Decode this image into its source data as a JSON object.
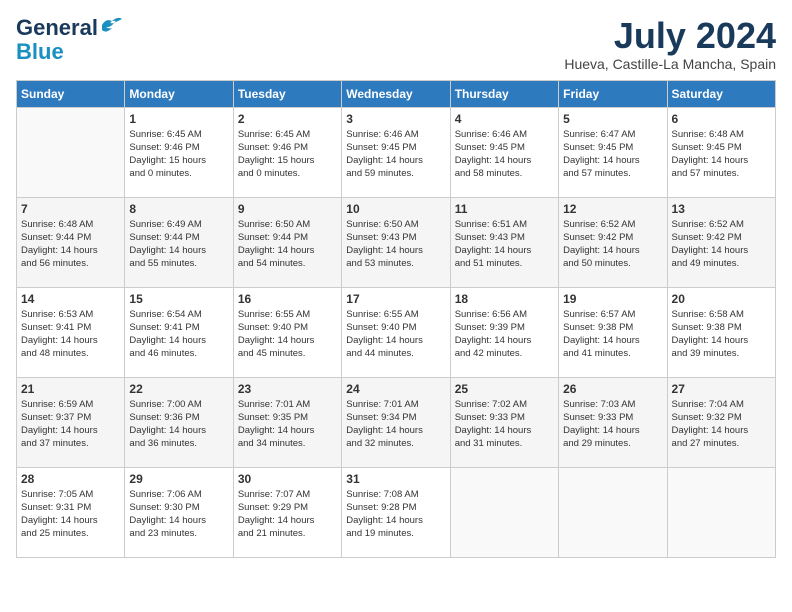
{
  "logo": {
    "general": "General",
    "blue": "Blue"
  },
  "title": "July 2024",
  "location": "Hueva, Castille-La Mancha, Spain",
  "days_of_week": [
    "Sunday",
    "Monday",
    "Tuesday",
    "Wednesday",
    "Thursday",
    "Friday",
    "Saturday"
  ],
  "weeks": [
    [
      {
        "day": "",
        "info": ""
      },
      {
        "day": "1",
        "info": "Sunrise: 6:45 AM\nSunset: 9:46 PM\nDaylight: 15 hours\nand 0 minutes."
      },
      {
        "day": "2",
        "info": "Sunrise: 6:45 AM\nSunset: 9:46 PM\nDaylight: 15 hours\nand 0 minutes."
      },
      {
        "day": "3",
        "info": "Sunrise: 6:46 AM\nSunset: 9:45 PM\nDaylight: 14 hours\nand 59 minutes."
      },
      {
        "day": "4",
        "info": "Sunrise: 6:46 AM\nSunset: 9:45 PM\nDaylight: 14 hours\nand 58 minutes."
      },
      {
        "day": "5",
        "info": "Sunrise: 6:47 AM\nSunset: 9:45 PM\nDaylight: 14 hours\nand 57 minutes."
      },
      {
        "day": "6",
        "info": "Sunrise: 6:48 AM\nSunset: 9:45 PM\nDaylight: 14 hours\nand 57 minutes."
      }
    ],
    [
      {
        "day": "7",
        "info": "Sunrise: 6:48 AM\nSunset: 9:44 PM\nDaylight: 14 hours\nand 56 minutes."
      },
      {
        "day": "8",
        "info": "Sunrise: 6:49 AM\nSunset: 9:44 PM\nDaylight: 14 hours\nand 55 minutes."
      },
      {
        "day": "9",
        "info": "Sunrise: 6:50 AM\nSunset: 9:44 PM\nDaylight: 14 hours\nand 54 minutes."
      },
      {
        "day": "10",
        "info": "Sunrise: 6:50 AM\nSunset: 9:43 PM\nDaylight: 14 hours\nand 53 minutes."
      },
      {
        "day": "11",
        "info": "Sunrise: 6:51 AM\nSunset: 9:43 PM\nDaylight: 14 hours\nand 51 minutes."
      },
      {
        "day": "12",
        "info": "Sunrise: 6:52 AM\nSunset: 9:42 PM\nDaylight: 14 hours\nand 50 minutes."
      },
      {
        "day": "13",
        "info": "Sunrise: 6:52 AM\nSunset: 9:42 PM\nDaylight: 14 hours\nand 49 minutes."
      }
    ],
    [
      {
        "day": "14",
        "info": "Sunrise: 6:53 AM\nSunset: 9:41 PM\nDaylight: 14 hours\nand 48 minutes."
      },
      {
        "day": "15",
        "info": "Sunrise: 6:54 AM\nSunset: 9:41 PM\nDaylight: 14 hours\nand 46 minutes."
      },
      {
        "day": "16",
        "info": "Sunrise: 6:55 AM\nSunset: 9:40 PM\nDaylight: 14 hours\nand 45 minutes."
      },
      {
        "day": "17",
        "info": "Sunrise: 6:55 AM\nSunset: 9:40 PM\nDaylight: 14 hours\nand 44 minutes."
      },
      {
        "day": "18",
        "info": "Sunrise: 6:56 AM\nSunset: 9:39 PM\nDaylight: 14 hours\nand 42 minutes."
      },
      {
        "day": "19",
        "info": "Sunrise: 6:57 AM\nSunset: 9:38 PM\nDaylight: 14 hours\nand 41 minutes."
      },
      {
        "day": "20",
        "info": "Sunrise: 6:58 AM\nSunset: 9:38 PM\nDaylight: 14 hours\nand 39 minutes."
      }
    ],
    [
      {
        "day": "21",
        "info": "Sunrise: 6:59 AM\nSunset: 9:37 PM\nDaylight: 14 hours\nand 37 minutes."
      },
      {
        "day": "22",
        "info": "Sunrise: 7:00 AM\nSunset: 9:36 PM\nDaylight: 14 hours\nand 36 minutes."
      },
      {
        "day": "23",
        "info": "Sunrise: 7:01 AM\nSunset: 9:35 PM\nDaylight: 14 hours\nand 34 minutes."
      },
      {
        "day": "24",
        "info": "Sunrise: 7:01 AM\nSunset: 9:34 PM\nDaylight: 14 hours\nand 32 minutes."
      },
      {
        "day": "25",
        "info": "Sunrise: 7:02 AM\nSunset: 9:33 PM\nDaylight: 14 hours\nand 31 minutes."
      },
      {
        "day": "26",
        "info": "Sunrise: 7:03 AM\nSunset: 9:33 PM\nDaylight: 14 hours\nand 29 minutes."
      },
      {
        "day": "27",
        "info": "Sunrise: 7:04 AM\nSunset: 9:32 PM\nDaylight: 14 hours\nand 27 minutes."
      }
    ],
    [
      {
        "day": "28",
        "info": "Sunrise: 7:05 AM\nSunset: 9:31 PM\nDaylight: 14 hours\nand 25 minutes."
      },
      {
        "day": "29",
        "info": "Sunrise: 7:06 AM\nSunset: 9:30 PM\nDaylight: 14 hours\nand 23 minutes."
      },
      {
        "day": "30",
        "info": "Sunrise: 7:07 AM\nSunset: 9:29 PM\nDaylight: 14 hours\nand 21 minutes."
      },
      {
        "day": "31",
        "info": "Sunrise: 7:08 AM\nSunset: 9:28 PM\nDaylight: 14 hours\nand 19 minutes."
      },
      {
        "day": "",
        "info": ""
      },
      {
        "day": "",
        "info": ""
      },
      {
        "day": "",
        "info": ""
      }
    ]
  ]
}
